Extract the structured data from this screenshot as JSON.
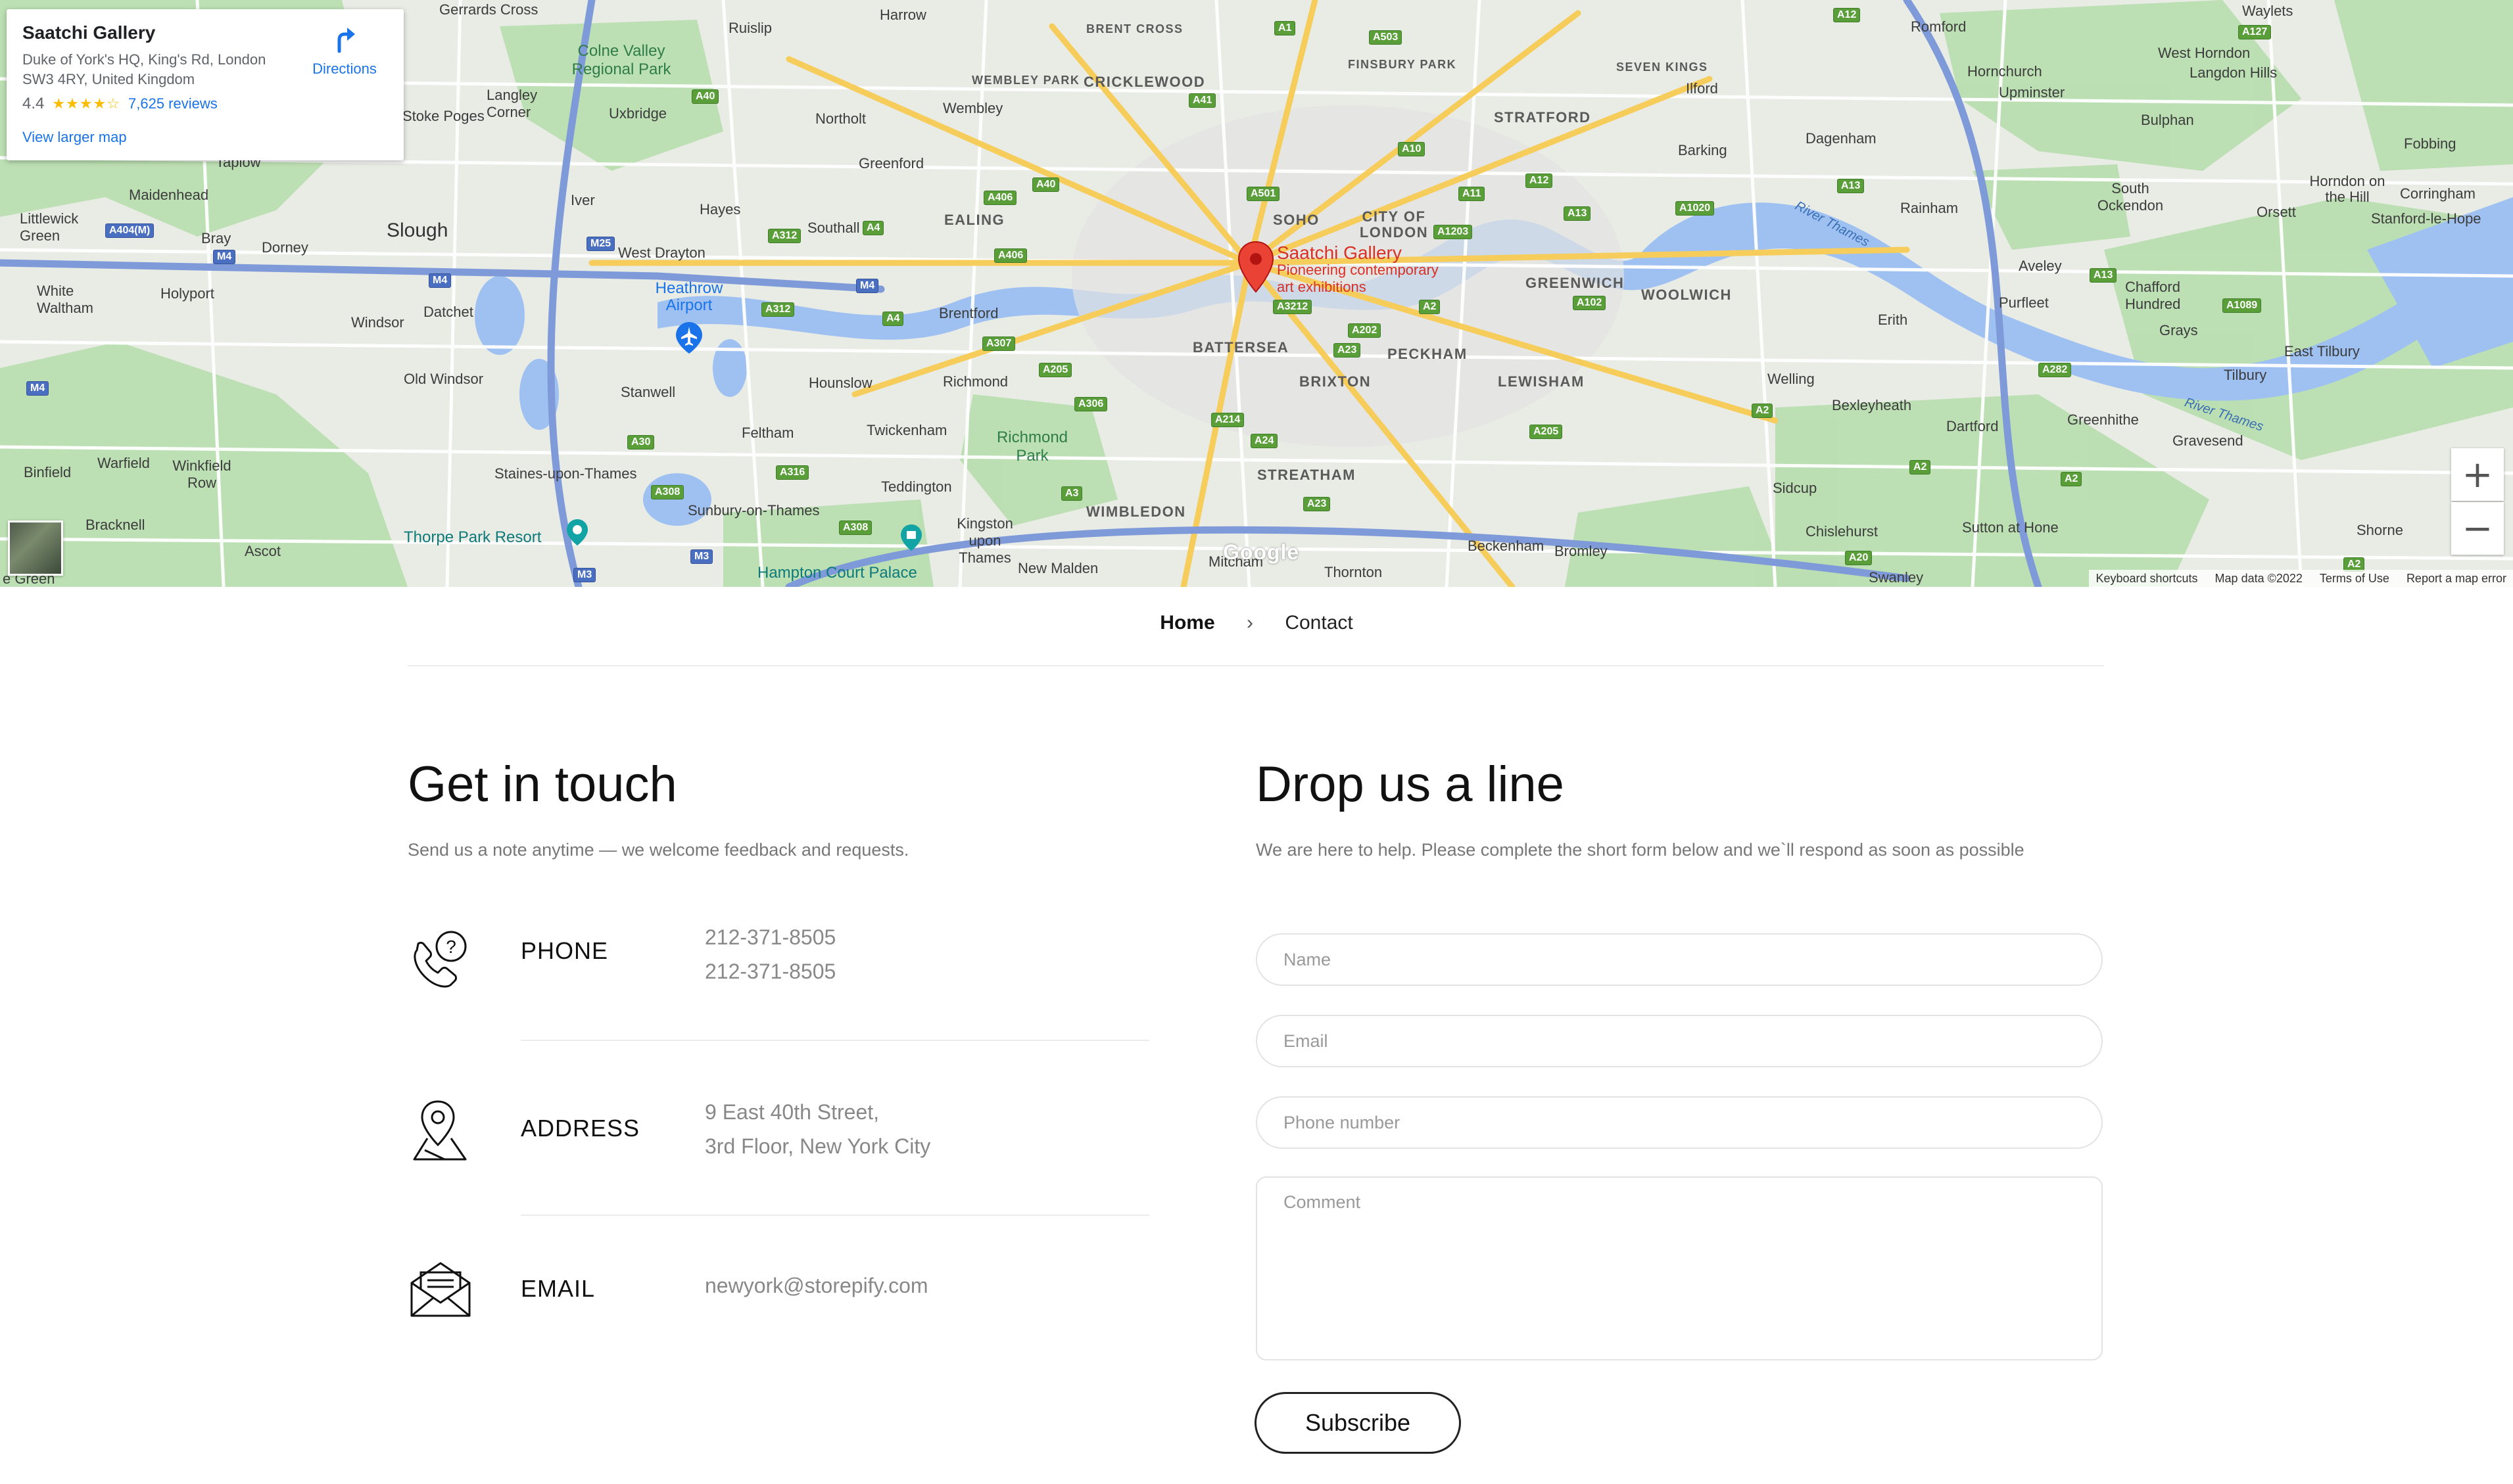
{
  "map": {
    "card": {
      "title": "Saatchi Gallery",
      "address": "Duke of York's HQ, King's Rd, London SW3 4RY, United Kingdom",
      "rating": "4.4",
      "stars": "★★★★☆",
      "reviews": "7,625 reviews",
      "directions": "Directions",
      "larger_map": "View larger map"
    },
    "pin": {
      "name": "Saatchi Gallery",
      "desc1": "Pioneering contemporary",
      "desc2": "art exhibitions"
    },
    "places": {
      "gerrards_cross": "Gerrards Cross",
      "harrow": "Harrow",
      "ruislip": "Ruislip",
      "brent_cross": "BRENT CROSS",
      "finsbury_park": "FINSBURY PARK",
      "romford": "Romford",
      "waylets": "Waylets",
      "west_horndon": "West Horndon",
      "colne_valley": "Colne Valley Regional Park",
      "langley": "Langley Corner",
      "wembley_park": "WEMBLEY PARK",
      "cricklewood": "CRICKLEWOOD",
      "seven_kings": "SEVEN KINGS",
      "hornchurch": "Hornchurch",
      "langdon_hills": "Langdon Hills",
      "upminster": "Upminster",
      "ilford": "Ilford",
      "stoke_poges": "Stoke Poges",
      "uxbridge": "Uxbridge",
      "northolt": "Northolt",
      "wembley": "Wembley",
      "stratford": "STRATFORD",
      "dagenham": "Dagenham",
      "bulphan": "Bulphan",
      "fobbing": "Fobbing",
      "taplow": "Taplow",
      "greenford": "Greenford",
      "barking": "Barking",
      "maidenhead": "Maidenhead",
      "iver": "Iver",
      "hayes": "Hayes",
      "ealing": "EALING",
      "soho": "SOHO",
      "city_of_london": "CITY OF LONDON",
      "rainham": "Rainham",
      "south_ockendon": "South Ockendon",
      "orsett": "Orsett",
      "horndon": "Horndon on the Hill",
      "stanford": "Stanford-le-Hope",
      "corringham": "Corringham",
      "littlewick": "Littlewick Green",
      "bray": "Bray",
      "slough": "Slough",
      "dorney": "Dorney",
      "southall": "Southall",
      "west_drayton": "West Drayton",
      "heathrow": "Heathrow Airport",
      "greenwich": "GREENWICH",
      "woolwich": "WOOLWICH",
      "white_waltham": "White Waltham",
      "holyport": "Holyport",
      "windsor": "Windsor",
      "datchet": "Datchet",
      "brentford": "Brentford",
      "batterseа": "BATTERSEA",
      "peckham": "PECKHAM",
      "aveley": "Aveley",
      "purfleet": "Purfleet",
      "chafford": "Chafford Hundred",
      "grays": "Grays",
      "east_tilbury": "East Tilbury",
      "erith": "Erith",
      "old_windsor": "Old Windsor",
      "stanwell": "Stanwell",
      "hounslow": "Hounslow",
      "richmond": "Richmond",
      "brixton": "BRIXTON",
      "lewisham": "LEWISHAM",
      "welling": "Welling",
      "tilbury": "Tilbury",
      "bexleyheath": "Bexleyheath",
      "dartford": "Dartford",
      "greenhithe": "Greenhithe",
      "gravesend": "Gravesend",
      "feltham": "Feltham",
      "twickenham": "Twickenham",
      "richmond_park": "Richmond Park",
      "binfield": "Binfield",
      "warfield": "Warfield",
      "winkfield_row": "Winkfield Row",
      "staines": "Staines-upon-Thames",
      "streatham": "STREATHAM",
      "teddington": "Teddington",
      "sidcup": "Sidcup",
      "sunbury": "Sunbury-on-Thames",
      "wimbledon": "WIMBLEDON",
      "bracknell": "Bracknell",
      "ascot": "Ascot",
      "thorpe_park": "Thorpe Park Resort",
      "kingston": "Kingston upon Thames",
      "chislehurst": "Chislehurst",
      "sutton_at_hone": "Sutton at Hone",
      "shorne": "Shorne",
      "hampton_court": "Hampton Court Palace",
      "new_malden": "New Malden",
      "mitcham": "Mitcham",
      "thornton": "Thornton",
      "beckenham": "Beckenham",
      "bromley": "Bromley",
      "swanley": "Swanley",
      "egreen": "e Green",
      "river_thames": "River Thames"
    },
    "google": "Google",
    "footer": {
      "shortcuts": "Keyboard shortcuts",
      "data": "Map data ©2022",
      "terms": "Terms of Use",
      "report": "Report a map error"
    },
    "zoom_in": "+",
    "zoom_out": "−"
  },
  "breadcrumb": {
    "home": "Home",
    "separator": "›",
    "current": "Contact"
  },
  "contact": {
    "heading": "Get in touch",
    "subtext": "Send us a note anytime — we welcome feedback and requests.",
    "phone": {
      "label": "PHONE",
      "lines": [
        "212-371-8505",
        "212-371-8505"
      ]
    },
    "address": {
      "label": "ADDRESS",
      "lines": [
        "9 East 40th Street,",
        "3rd Floor, New York City"
      ]
    },
    "email": {
      "label": "EMAIL",
      "lines": [
        "newyork@storepify.com"
      ]
    }
  },
  "form": {
    "heading": "Drop us a line",
    "subtext": "We are here to help. Please complete the short form below and we`ll respond as soon as possible",
    "name_placeholder": "Name",
    "email_placeholder": "Email",
    "phone_placeholder": "Phone number",
    "comment_placeholder": "Comment",
    "submit": "Subscribe"
  }
}
